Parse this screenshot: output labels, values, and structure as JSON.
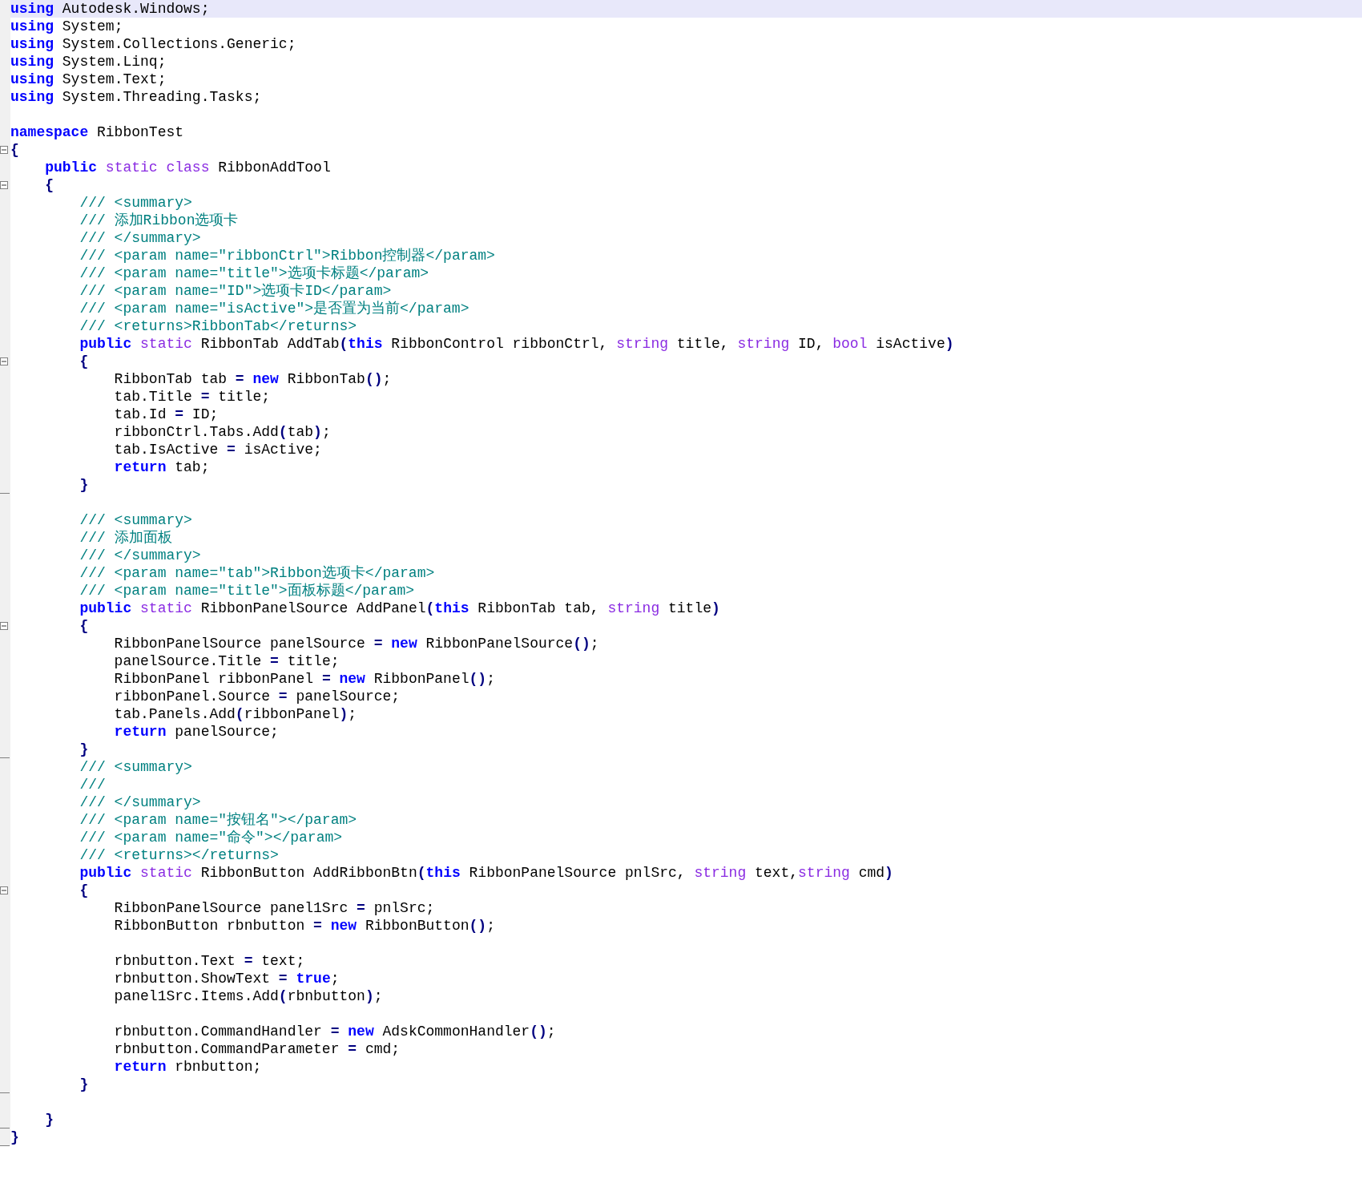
{
  "editor": {
    "lines": [
      {
        "current": true,
        "kind": "plain",
        "tokens": [
          {
            "kind": "keyword",
            "text": "using"
          },
          {
            "kind": "text",
            "text": " Autodesk.Windows;"
          }
        ]
      },
      {
        "current": false,
        "kind": "plain",
        "tokens": [
          {
            "kind": "keyword",
            "text": "using"
          },
          {
            "kind": "text",
            "text": " System;"
          }
        ]
      },
      {
        "current": false,
        "kind": "plain",
        "tokens": [
          {
            "kind": "keyword",
            "text": "using"
          },
          {
            "kind": "text",
            "text": " System.Collections.Generic;"
          }
        ]
      },
      {
        "current": false,
        "kind": "plain",
        "tokens": [
          {
            "kind": "keyword",
            "text": "using"
          },
          {
            "kind": "text",
            "text": " System.Linq;"
          }
        ]
      },
      {
        "current": false,
        "kind": "plain",
        "tokens": [
          {
            "kind": "keyword",
            "text": "using"
          },
          {
            "kind": "text",
            "text": " System.Text;"
          }
        ]
      },
      {
        "current": false,
        "kind": "plain",
        "tokens": [
          {
            "kind": "keyword",
            "text": "using"
          },
          {
            "kind": "text",
            "text": " System.Threading.Tasks;"
          }
        ]
      },
      {
        "current": false,
        "kind": "plain"
      },
      {
        "current": false,
        "kind": "plain",
        "tokens": [
          {
            "kind": "keyword",
            "text": "namespace"
          },
          {
            "kind": "text",
            "text": " RibbonTest"
          }
        ]
      },
      {
        "current": false,
        "kind": "open",
        "tokens": [
          {
            "kind": "op",
            "text": "{"
          }
        ]
      },
      {
        "current": false,
        "kind": "plain",
        "tokens": [
          {
            "kind": "keyword",
            "text": "    public"
          },
          {
            "kind": "modifier",
            "text": " static class"
          },
          {
            "kind": "text",
            "text": " RibbonAddTool"
          }
        ]
      },
      {
        "current": false,
        "kind": "open",
        "tokens": [
          {
            "kind": "op",
            "text": "    {"
          }
        ]
      },
      {
        "current": false,
        "kind": "plain",
        "tokens": [
          {
            "kind": "comment",
            "text": "        /// <summary>"
          }
        ]
      },
      {
        "current": false,
        "kind": "plain",
        "tokens": [
          {
            "kind": "comment",
            "text": "        /// 添加Ribbon选项卡"
          }
        ]
      },
      {
        "current": false,
        "kind": "plain",
        "tokens": [
          {
            "kind": "comment",
            "text": "        /// </summary>"
          }
        ]
      },
      {
        "current": false,
        "kind": "plain",
        "tokens": [
          {
            "kind": "comment",
            "text": "        /// <param name=\"ribbonCtrl\">Ribbon控制器</param>"
          }
        ]
      },
      {
        "current": false,
        "kind": "plain",
        "tokens": [
          {
            "kind": "comment",
            "text": "        /// <param name=\"title\">选项卡标题</param>"
          }
        ]
      },
      {
        "current": false,
        "kind": "plain",
        "tokens": [
          {
            "kind": "comment",
            "text": "        /// <param name=\"ID\">选项卡ID</param>"
          }
        ]
      },
      {
        "current": false,
        "kind": "plain",
        "tokens": [
          {
            "kind": "comment",
            "text": "        /// <param name=\"isActive\">是否置为当前</param>"
          }
        ]
      },
      {
        "current": false,
        "kind": "plain",
        "tokens": [
          {
            "kind": "comment",
            "text": "        /// <returns>RibbonTab</returns>"
          }
        ]
      },
      {
        "current": false,
        "kind": "plain",
        "tokens": [
          {
            "kind": "keyword",
            "text": "        public"
          },
          {
            "kind": "modifier",
            "text": " static"
          },
          {
            "kind": "text",
            "text": " RibbonTab AddTab"
          },
          {
            "kind": "op",
            "text": "("
          },
          {
            "kind": "keyword",
            "text": "this"
          },
          {
            "kind": "text",
            "text": " RibbonControl ribbonCtrl, "
          },
          {
            "kind": "modifier",
            "text": "string"
          },
          {
            "kind": "text",
            "text": " title, "
          },
          {
            "kind": "modifier",
            "text": "string"
          },
          {
            "kind": "text",
            "text": " ID, "
          },
          {
            "kind": "modifier",
            "text": "bool"
          },
          {
            "kind": "text",
            "text": " isActive"
          },
          {
            "kind": "op",
            "text": ")"
          }
        ]
      },
      {
        "current": false,
        "kind": "open",
        "tokens": [
          {
            "kind": "op",
            "text": "        {"
          }
        ]
      },
      {
        "current": false,
        "kind": "plain",
        "tokens": [
          {
            "kind": "text",
            "text": "            RibbonTab tab "
          },
          {
            "kind": "op",
            "text": "="
          },
          {
            "kind": "keyword",
            "text": " new"
          },
          {
            "kind": "text",
            "text": " RibbonTab"
          },
          {
            "kind": "op",
            "text": "()"
          },
          {
            "kind": "text",
            "text": ";"
          }
        ]
      },
      {
        "current": false,
        "kind": "plain",
        "tokens": [
          {
            "kind": "text",
            "text": "            tab.Title "
          },
          {
            "kind": "op",
            "text": "="
          },
          {
            "kind": "text",
            "text": " title;"
          }
        ]
      },
      {
        "current": false,
        "kind": "plain",
        "tokens": [
          {
            "kind": "text",
            "text": "            tab.Id "
          },
          {
            "kind": "op",
            "text": "="
          },
          {
            "kind": "text",
            "text": " ID;"
          }
        ]
      },
      {
        "current": false,
        "kind": "plain",
        "tokens": [
          {
            "kind": "text",
            "text": "            ribbonCtrl.Tabs.Add"
          },
          {
            "kind": "op",
            "text": "("
          },
          {
            "kind": "text",
            "text": "tab"
          },
          {
            "kind": "op",
            "text": ")"
          },
          {
            "kind": "text",
            "text": ";"
          }
        ]
      },
      {
        "current": false,
        "kind": "plain",
        "tokens": [
          {
            "kind": "text",
            "text": "            tab.IsActive "
          },
          {
            "kind": "op",
            "text": "="
          },
          {
            "kind": "text",
            "text": " isActive;"
          }
        ]
      },
      {
        "current": false,
        "kind": "plain",
        "tokens": [
          {
            "kind": "keyword",
            "text": "            return"
          },
          {
            "kind": "text",
            "text": " tab;"
          }
        ]
      },
      {
        "current": false,
        "kind": "close",
        "tokens": [
          {
            "kind": "op",
            "text": "        }"
          }
        ]
      },
      {
        "current": false,
        "kind": "plain"
      },
      {
        "current": false,
        "kind": "plain",
        "tokens": [
          {
            "kind": "comment",
            "text": "        /// <summary>"
          }
        ]
      },
      {
        "current": false,
        "kind": "plain",
        "tokens": [
          {
            "kind": "comment",
            "text": "        /// 添加面板"
          }
        ]
      },
      {
        "current": false,
        "kind": "plain",
        "tokens": [
          {
            "kind": "comment",
            "text": "        /// </summary>"
          }
        ]
      },
      {
        "current": false,
        "kind": "plain",
        "tokens": [
          {
            "kind": "comment",
            "text": "        /// <param name=\"tab\">Ribbon选项卡</param>"
          }
        ]
      },
      {
        "current": false,
        "kind": "plain",
        "tokens": [
          {
            "kind": "comment",
            "text": "        /// <param name=\"title\">面板标题</param>"
          }
        ]
      },
      {
        "current": false,
        "kind": "plain",
        "tokens": [
          {
            "kind": "keyword",
            "text": "        public"
          },
          {
            "kind": "modifier",
            "text": " static"
          },
          {
            "kind": "text",
            "text": " RibbonPanelSource AddPanel"
          },
          {
            "kind": "op",
            "text": "("
          },
          {
            "kind": "keyword",
            "text": "this"
          },
          {
            "kind": "text",
            "text": " RibbonTab tab, "
          },
          {
            "kind": "modifier",
            "text": "string"
          },
          {
            "kind": "text",
            "text": " title"
          },
          {
            "kind": "op",
            "text": ")"
          }
        ]
      },
      {
        "current": false,
        "kind": "open",
        "tokens": [
          {
            "kind": "op",
            "text": "        {"
          }
        ]
      },
      {
        "current": false,
        "kind": "plain",
        "tokens": [
          {
            "kind": "text",
            "text": "            RibbonPanelSource panelSource "
          },
          {
            "kind": "op",
            "text": "="
          },
          {
            "kind": "keyword",
            "text": " new"
          },
          {
            "kind": "text",
            "text": " RibbonPanelSource"
          },
          {
            "kind": "op",
            "text": "()"
          },
          {
            "kind": "text",
            "text": ";"
          }
        ]
      },
      {
        "current": false,
        "kind": "plain",
        "tokens": [
          {
            "kind": "text",
            "text": "            panelSource.Title "
          },
          {
            "kind": "op",
            "text": "="
          },
          {
            "kind": "text",
            "text": " title;"
          }
        ]
      },
      {
        "current": false,
        "kind": "plain",
        "tokens": [
          {
            "kind": "text",
            "text": "            RibbonPanel ribbonPanel "
          },
          {
            "kind": "op",
            "text": "="
          },
          {
            "kind": "keyword",
            "text": " new"
          },
          {
            "kind": "text",
            "text": " RibbonPanel"
          },
          {
            "kind": "op",
            "text": "()"
          },
          {
            "kind": "text",
            "text": ";"
          }
        ]
      },
      {
        "current": false,
        "kind": "plain",
        "tokens": [
          {
            "kind": "text",
            "text": "            ribbonPanel.Source "
          },
          {
            "kind": "op",
            "text": "="
          },
          {
            "kind": "text",
            "text": " panelSource;"
          }
        ]
      },
      {
        "current": false,
        "kind": "plain",
        "tokens": [
          {
            "kind": "text",
            "text": "            tab.Panels.Add"
          },
          {
            "kind": "op",
            "text": "("
          },
          {
            "kind": "text",
            "text": "ribbonPanel"
          },
          {
            "kind": "op",
            "text": ")"
          },
          {
            "kind": "text",
            "text": ";"
          }
        ]
      },
      {
        "current": false,
        "kind": "plain",
        "tokens": [
          {
            "kind": "keyword",
            "text": "            return"
          },
          {
            "kind": "text",
            "text": " panelSource;"
          }
        ]
      },
      {
        "current": false,
        "kind": "close",
        "tokens": [
          {
            "kind": "op",
            "text": "        }"
          }
        ]
      },
      {
        "current": false,
        "kind": "plain",
        "tokens": [
          {
            "kind": "comment",
            "text": "        /// <summary>"
          }
        ]
      },
      {
        "current": false,
        "kind": "plain",
        "tokens": [
          {
            "kind": "comment",
            "text": "        ///"
          }
        ]
      },
      {
        "current": false,
        "kind": "plain",
        "tokens": [
          {
            "kind": "comment",
            "text": "        /// </summary>"
          }
        ]
      },
      {
        "current": false,
        "kind": "plain",
        "tokens": [
          {
            "kind": "comment",
            "text": "        /// <param name=\"按钮名\"></param>"
          }
        ]
      },
      {
        "current": false,
        "kind": "plain",
        "tokens": [
          {
            "kind": "comment",
            "text": "        /// <param name=\"命令\"></param>"
          }
        ]
      },
      {
        "current": false,
        "kind": "plain",
        "tokens": [
          {
            "kind": "comment",
            "text": "        /// <returns></returns>"
          }
        ]
      },
      {
        "current": false,
        "kind": "plain",
        "tokens": [
          {
            "kind": "keyword",
            "text": "        public"
          },
          {
            "kind": "modifier",
            "text": " static"
          },
          {
            "kind": "text",
            "text": " RibbonButton AddRibbonBtn"
          },
          {
            "kind": "op",
            "text": "("
          },
          {
            "kind": "keyword",
            "text": "this"
          },
          {
            "kind": "text",
            "text": " RibbonPanelSource pnlSrc, "
          },
          {
            "kind": "modifier",
            "text": "string"
          },
          {
            "kind": "text",
            "text": " text,"
          },
          {
            "kind": "modifier",
            "text": "string"
          },
          {
            "kind": "text",
            "text": " cmd"
          },
          {
            "kind": "op",
            "text": ")"
          }
        ]
      },
      {
        "current": false,
        "kind": "open",
        "tokens": [
          {
            "kind": "op",
            "text": "        {"
          }
        ]
      },
      {
        "current": false,
        "kind": "plain",
        "tokens": [
          {
            "kind": "text",
            "text": "            RibbonPanelSource panel1Src "
          },
          {
            "kind": "op",
            "text": "="
          },
          {
            "kind": "text",
            "text": " pnlSrc;"
          }
        ]
      },
      {
        "current": false,
        "kind": "plain",
        "tokens": [
          {
            "kind": "text",
            "text": "            RibbonButton rbnbutton "
          },
          {
            "kind": "op",
            "text": "="
          },
          {
            "kind": "keyword",
            "text": " new"
          },
          {
            "kind": "text",
            "text": " RibbonButton"
          },
          {
            "kind": "op",
            "text": "()"
          },
          {
            "kind": "text",
            "text": ";"
          }
        ]
      },
      {
        "current": false,
        "kind": "plain"
      },
      {
        "current": false,
        "kind": "plain",
        "tokens": [
          {
            "kind": "text",
            "text": "            rbnbutton.Text "
          },
          {
            "kind": "op",
            "text": "="
          },
          {
            "kind": "text",
            "text": " text;"
          }
        ]
      },
      {
        "current": false,
        "kind": "plain",
        "tokens": [
          {
            "kind": "text",
            "text": "            rbnbutton.ShowText "
          },
          {
            "kind": "op",
            "text": "="
          },
          {
            "kind": "keyword",
            "text": " true"
          },
          {
            "kind": "text",
            "text": ";"
          }
        ]
      },
      {
        "current": false,
        "kind": "plain",
        "tokens": [
          {
            "kind": "text",
            "text": "            panel1Src.Items.Add"
          },
          {
            "kind": "op",
            "text": "("
          },
          {
            "kind": "text",
            "text": "rbnbutton"
          },
          {
            "kind": "op",
            "text": ")"
          },
          {
            "kind": "text",
            "text": ";"
          }
        ]
      },
      {
        "current": false,
        "kind": "plain"
      },
      {
        "current": false,
        "kind": "plain",
        "tokens": [
          {
            "kind": "text",
            "text": "            rbnbutton.CommandHandler "
          },
          {
            "kind": "op",
            "text": "="
          },
          {
            "kind": "keyword",
            "text": " new"
          },
          {
            "kind": "text",
            "text": " AdskCommonHandler"
          },
          {
            "kind": "op",
            "text": "()"
          },
          {
            "kind": "text",
            "text": ";"
          }
        ]
      },
      {
        "current": false,
        "kind": "plain",
        "tokens": [
          {
            "kind": "text",
            "text": "            rbnbutton.CommandParameter "
          },
          {
            "kind": "op",
            "text": "="
          },
          {
            "kind": "text",
            "text": " cmd;"
          }
        ]
      },
      {
        "current": false,
        "kind": "plain",
        "tokens": [
          {
            "kind": "keyword",
            "text": "            return"
          },
          {
            "kind": "text",
            "text": " rbnbutton;"
          }
        ]
      },
      {
        "current": false,
        "kind": "close",
        "tokens": [
          {
            "kind": "op",
            "text": "        }"
          }
        ]
      },
      {
        "current": false,
        "kind": "plain"
      },
      {
        "current": false,
        "kind": "close",
        "tokens": [
          {
            "kind": "op",
            "text": "    }"
          }
        ]
      },
      {
        "current": false,
        "kind": "close",
        "tokens": [
          {
            "kind": "op",
            "text": "}"
          }
        ]
      }
    ]
  }
}
